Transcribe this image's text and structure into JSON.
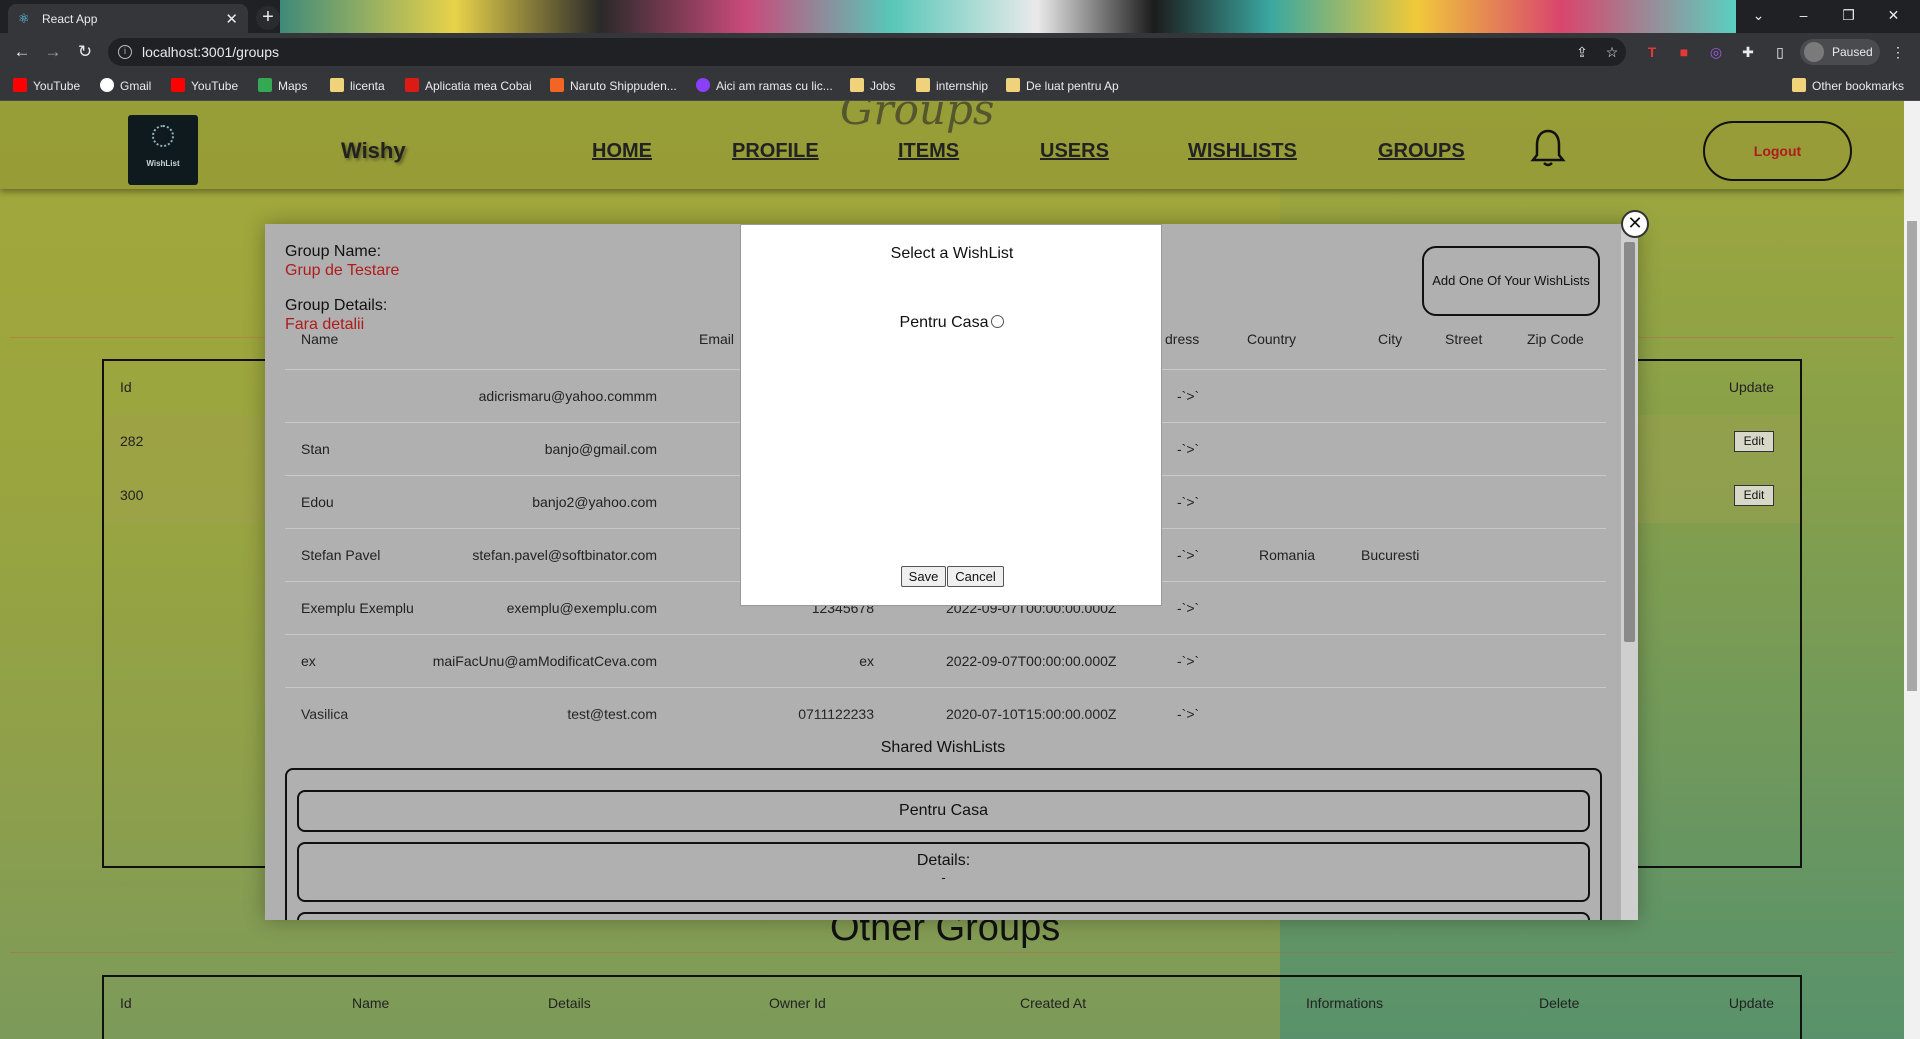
{
  "browser": {
    "tab_title": "React App",
    "tab_icon": "react-logo",
    "url": "localhost:3001/groups",
    "profile_label": "Paused",
    "window_controls": [
      "chevron-down-icon",
      "minimize-icon",
      "restore-icon",
      "close-icon"
    ],
    "bookmarks": [
      {
        "label": "YouTube",
        "icon": "youtube-icon",
        "color": "#ff0000"
      },
      {
        "label": "Gmail",
        "icon": "google-icon",
        "color": "#ffffff"
      },
      {
        "label": "YouTube",
        "icon": "youtube-icon",
        "color": "#ff0000"
      },
      {
        "label": "Maps",
        "icon": "maps-icon",
        "color": "#34a853"
      },
      {
        "label": "licenta",
        "icon": "folder-icon",
        "color": "#f0d27a"
      },
      {
        "label": "Aplicatia mea Cobai",
        "icon": "angular-icon",
        "color": "#dd1b16"
      },
      {
        "label": "Naruto Shippuden...",
        "icon": "f-icon",
        "color": "#f26522"
      },
      {
        "label": "Aici am ramas cu lic...",
        "icon": "app-icon",
        "color": "#8a3ffc"
      },
      {
        "label": "Jobs",
        "icon": "folder-icon",
        "color": "#f0d27a"
      },
      {
        "label": "internship",
        "icon": "folder-icon",
        "color": "#f0d27a"
      },
      {
        "label": "De luat pentru Ap",
        "icon": "folder-icon",
        "color": "#f0d27a"
      }
    ],
    "other_bookmarks": "Other bookmarks"
  },
  "navbar": {
    "logo_text": "WishList",
    "brand": "Wishy",
    "links": [
      "HOME",
      "PROFILE",
      "ITEMS",
      "USERS",
      "WISHLISTS",
      "GROUPS"
    ],
    "logout": "Logout"
  },
  "background_table": {
    "headers": {
      "id": "Id",
      "update": "Update"
    },
    "rows": [
      {
        "id": "282",
        "action": "Edit"
      },
      {
        "id": "300",
        "action": "Edit"
      }
    ]
  },
  "other_groups": {
    "title": "Other Groups",
    "headers": [
      "Id",
      "Name",
      "Details",
      "Owner Id",
      "Created At",
      "Informations",
      "Delete",
      "Update"
    ]
  },
  "group_modal": {
    "close": "✕",
    "group_name_label": "Group Name:",
    "group_name": "Grup de Testare",
    "group_details_label": "Group Details:",
    "group_details": "Fara detalii",
    "add_button": "Add One Of Your WishLists",
    "headers": {
      "name": "Name",
      "email": "Email",
      "address": "dress",
      "country": "Country",
      "city": "City",
      "street": "Street",
      "zip": "Zip Code"
    },
    "users": [
      {
        "name": "",
        "email": "adicrismaru@yahoo.commm",
        "phone": "",
        "date": "",
        "arrow": "-`>`",
        "country": "",
        "city": ""
      },
      {
        "name": "Stan",
        "email": "banjo@gmail.com",
        "phone": "",
        "date": "",
        "arrow": "-`>`",
        "country": "",
        "city": ""
      },
      {
        "name": "Edou",
        "email": "banjo2@yahoo.com",
        "phone": "",
        "date": "",
        "arrow": "-`>`",
        "country": "",
        "city": ""
      },
      {
        "name": "Stefan Pavel",
        "email": "stefan.pavel@softbinator.com",
        "phone": "",
        "date": "",
        "arrow": "-`>`",
        "country": "Romania",
        "city": "Bucuresti"
      },
      {
        "name": "Exemplu Exemplu",
        "email": "exemplu@exemplu.com",
        "phone": "12345678",
        "date": "2022-09-07T00:00:00.000Z",
        "arrow": "-`>`",
        "country": "",
        "city": ""
      },
      {
        "name": "ex",
        "email": "maiFacUnu@amModificatCeva.com",
        "phone": "ex",
        "date": "2022-09-07T00:00:00.000Z",
        "arrow": "-`>`",
        "country": "",
        "city": ""
      },
      {
        "name": "Vasilica",
        "email": "test@test.com",
        "phone": "0711122233",
        "date": "2020-07-10T15:00:00.000Z",
        "arrow": "-`>`",
        "country": "",
        "city": ""
      }
    ],
    "shared_title": "Shared WishLists",
    "shared": {
      "name": "Pentru Casa",
      "details_label": "Details:",
      "details_value": "-"
    }
  },
  "dialog": {
    "title": "Select a WishList",
    "option": "Pentru Casa",
    "save": "Save",
    "cancel": "Cancel"
  }
}
